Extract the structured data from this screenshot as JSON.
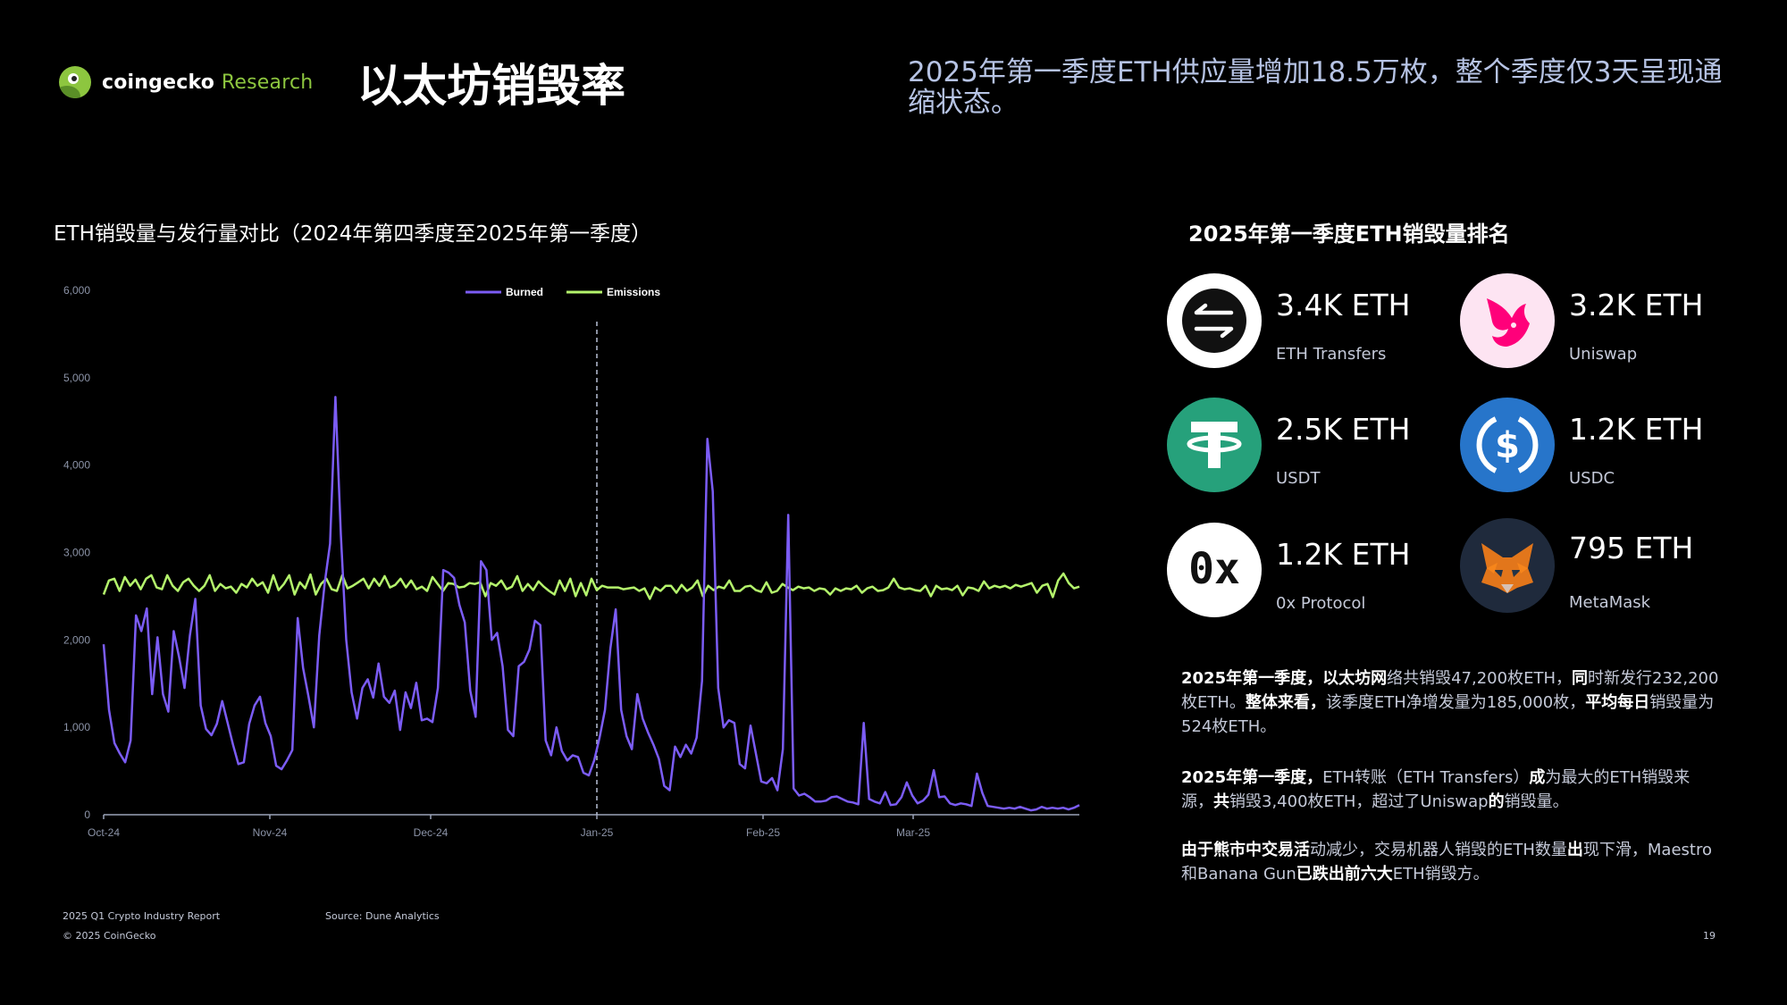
{
  "brand": {
    "name": "coingecko",
    "suffix": "Research"
  },
  "page_title": "以太坊销毁率",
  "headline": "2025年第一季度ETH供应量增加18.5万枚，整个季度仅3天呈现通缩状态。",
  "chart_title": "ETH销毁量与发行量对比（2024年第四季度至2025年第一季度）",
  "ranking": {
    "title": "2025年第一季度ETH销毁量排名",
    "items": [
      {
        "value": "3.4K ETH",
        "label": "ETH Transfers",
        "icon": "eth-transfers-icon",
        "color": "#ffffff"
      },
      {
        "value": "3.2K ETH",
        "label": "Uniswap",
        "icon": "uniswap-icon",
        "color": "#fde4f2"
      },
      {
        "value": "2.5K ETH",
        "label": "USDT",
        "icon": "usdt-icon",
        "color": "#26a17b"
      },
      {
        "value": "1.2K ETH",
        "label": "USDC",
        "icon": "usdc-icon",
        "color": "#2775ca"
      },
      {
        "value": "1.2K ETH",
        "label": "0x Protocol",
        "icon": "0x-icon",
        "color": "#ffffff"
      },
      {
        "value": "795 ETH",
        "label": "MetaMask",
        "icon": "metamask-icon",
        "color": "#1f2a3c"
      }
    ]
  },
  "paragraphs": [
    {
      "parts": [
        {
          "t": "2025年第一季度，",
          "b": true
        },
        {
          "t": "以太坊网",
          "b": true
        },
        {
          "t": "络共销毁47,200枚ETH，",
          "b": false
        },
        {
          "t": "同",
          "b": true
        },
        {
          "t": "时新发行232,200枚ETH。",
          "b": false
        },
        {
          "t": "整体来看，",
          "b": true
        },
        {
          "t": "该季度ETH净增发量为185,000枚，",
          "b": false
        },
        {
          "t": "平均每日",
          "b": true
        },
        {
          "t": "销毁量为524枚ETH。",
          "b": false
        }
      ]
    },
    {
      "parts": [
        {
          "t": "2025年第一季度，",
          "b": true
        },
        {
          "t": "ETH转账（ETH Transfers）",
          "b": false
        },
        {
          "t": "成",
          "b": true
        },
        {
          "t": "为最大的ETH销毁来源，",
          "b": false
        },
        {
          "t": "共",
          "b": true
        },
        {
          "t": "销毁3,400枚ETH，超过了Uniswap",
          "b": false
        },
        {
          "t": "的",
          "b": true
        },
        {
          "t": "销毁量。",
          "b": false
        }
      ]
    },
    {
      "parts": [
        {
          "t": "由于熊市中交易活",
          "b": true
        },
        {
          "t": "动减少，交易机器人销毁的ETH数量",
          "b": false
        },
        {
          "t": "出",
          "b": true
        },
        {
          "t": "现下滑，Maestro和Banana Gun",
          "b": false
        },
        {
          "t": "已跌出前六大",
          "b": true
        },
        {
          "t": "ETH销毁方。",
          "b": false
        }
      ]
    }
  ],
  "footer": {
    "report": "2025 Q1 Crypto Industry Report",
    "copyright": "© 2025 CoinGecko",
    "source": "Source: Dune Analytics",
    "page_number": "19"
  },
  "colors": {
    "burned": "#7b5cf5",
    "emissions": "#b4f46c",
    "axis": "#8c94a8",
    "headline": "#b6c3e4",
    "brand": "#8dc63f"
  },
  "chart_data": {
    "type": "line",
    "ylim": [
      0,
      6000
    ],
    "y_ticks": [
      "0",
      "1,000",
      "2,000",
      "3,000",
      "4,000",
      "5,000",
      "6,000"
    ],
    "x_ticks": [
      {
        "label": "Oct-24",
        "day": 0
      },
      {
        "label": "Nov-24",
        "day": 31
      },
      {
        "label": "Dec-24",
        "day": 61
      },
      {
        "label": "Jan-25",
        "day": 92
      },
      {
        "label": "Feb-25",
        "day": 123
      },
      {
        "label": "Mar-25",
        "day": 151
      }
    ],
    "x_range": [
      0,
      182
    ],
    "divider_day": 92,
    "legend": {
      "position": "top-center"
    },
    "series": [
      {
        "name": "Burned",
        "values": [
          1950,
          1200,
          820,
          700,
          600,
          850,
          2280,
          2100,
          2360,
          1380,
          2030,
          1380,
          1180,
          2100,
          1800,
          1450,
          2050,
          2470,
          1250,
          980,
          910,
          1040,
          1300,
          1050,
          800,
          580,
          600,
          1040,
          1250,
          1350,
          1050,
          900,
          560,
          520,
          620,
          740,
          2250,
          1680,
          1350,
          1000,
          2050,
          2650,
          3100,
          4780,
          3200,
          2000,
          1400,
          1100,
          1450,
          1550,
          1340,
          1730,
          1350,
          1280,
          1420,
          970,
          1400,
          1220,
          1510,
          1080,
          1100,
          1060,
          1450,
          2800,
          2770,
          2710,
          2400,
          2200,
          1420,
          1120,
          2900,
          2800,
          2000,
          2080,
          1700,
          970,
          900,
          1700,
          1750,
          1890,
          2220,
          2170,
          850,
          680,
          1000,
          730,
          620,
          680,
          660,
          480,
          450,
          620,
          880,
          1200,
          1900,
          2350,
          1200,
          900,
          750,
          1380,
          1100,
          940,
          800,
          640,
          330,
          280,
          780,
          660,
          800,
          700,
          880,
          1530,
          4300,
          3700,
          1450,
          1000,
          1080,
          1050,
          580,
          530,
          1020,
          700,
          380,
          360,
          420,
          280,
          750,
          3430,
          300,
          220,
          240,
          200,
          150,
          150,
          160,
          200,
          210,
          180,
          150,
          140,
          120,
          1050,
          180,
          150,
          130,
          260,
          110,
          120,
          200,
          370,
          220,
          130,
          160,
          230,
          510,
          200,
          210,
          130,
          110,
          130,
          120,
          100,
          470,
          250,
          100,
          90,
          80,
          70,
          80,
          70,
          90,
          70,
          50,
          60,
          90,
          70,
          80,
          70,
          80,
          60,
          80,
          110
        ]
      },
      {
        "name": "Emissions",
        "values": [
          2520,
          2680,
          2700,
          2560,
          2720,
          2620,
          2690,
          2580,
          2700,
          2740,
          2600,
          2580,
          2740,
          2620,
          2560,
          2660,
          2700,
          2620,
          2560,
          2620,
          2740,
          2560,
          2640,
          2590,
          2610,
          2540,
          2640,
          2600,
          2700,
          2620,
          2660,
          2540,
          2740,
          2570,
          2640,
          2740,
          2520,
          2660,
          2590,
          2750,
          2520,
          2640,
          2700,
          2580,
          2560,
          2740,
          2590,
          2620,
          2660,
          2700,
          2590,
          2700,
          2620,
          2730,
          2600,
          2630,
          2700,
          2600,
          2680,
          2580,
          2610,
          2560,
          2720,
          2640,
          2560,
          2650,
          2640,
          2600,
          2610,
          2650,
          2640,
          2660,
          2500,
          2650,
          2620,
          2680,
          2580,
          2610,
          2730,
          2560,
          2640,
          2570,
          2670,
          2610,
          2560,
          2520,
          2680,
          2560,
          2700,
          2500,
          2650,
          2510,
          2700,
          2570,
          2620,
          2600,
          2600,
          2600,
          2580,
          2590,
          2600,
          2560,
          2590,
          2470,
          2600,
          2560,
          2620,
          2620,
          2540,
          2630,
          2560,
          2600,
          2680,
          2500,
          2620,
          2570,
          2610,
          2590,
          2680,
          2560,
          2560,
          2610,
          2620,
          2570,
          2550,
          2660,
          2540,
          2560,
          2640,
          2600,
          2570,
          2610,
          2590,
          2600,
          2560,
          2590,
          2580,
          2520,
          2590,
          2560,
          2590,
          2580,
          2620,
          2540,
          2590,
          2610,
          2560,
          2570,
          2600,
          2700,
          2600,
          2580,
          2590,
          2570,
          2560,
          2620,
          2500,
          2620,
          2580,
          2590,
          2570,
          2620,
          2510,
          2600,
          2590,
          2560,
          2670,
          2590,
          2620,
          2600,
          2620,
          2590,
          2630,
          2610,
          2630,
          2650,
          2540,
          2620,
          2640,
          2490,
          2680,
          2760,
          2650,
          2590,
          2610
        ]
      }
    ]
  }
}
